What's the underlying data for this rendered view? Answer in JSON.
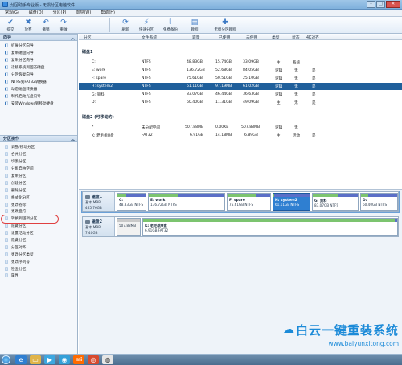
{
  "window": {
    "title": "分区助手专业版 - 无损分区电脑软件",
    "minimize": "–",
    "maximize": "□",
    "close": "✕"
  },
  "menu": [
    "常规(G)",
    "磁盘(D)",
    "分区(P)",
    "向导(W)",
    "帮助(H)"
  ],
  "toolbar": {
    "left": [
      {
        "label": "提交",
        "icon": "✔"
      },
      {
        "label": "放弃",
        "icon": "✖"
      },
      {
        "label": "撤销",
        "icon": "↶"
      },
      {
        "label": "重做",
        "icon": "↷"
      }
    ],
    "right": [
      {
        "label": "刷新",
        "icon": "⟳"
      },
      {
        "label": "快速分区",
        "icon": "⚡"
      },
      {
        "label": "免费备份",
        "icon": "⇩"
      },
      {
        "label": "教程",
        "icon": "▤"
      },
      {
        "label": "无损分区教程",
        "icon": "✚"
      }
    ]
  },
  "sidebar": {
    "wizard": {
      "header": "向导",
      "collapse": "︽",
      "items": [
        {
          "label": "扩展分区向导",
          "icon": "◧"
        },
        {
          "label": "复制磁盘向导",
          "icon": "◧"
        },
        {
          "label": "复制分区向导",
          "icon": "◧"
        },
        {
          "label": "迁移系统到固态硬盘",
          "icon": "◧"
        },
        {
          "label": "分区恢复向导",
          "icon": "◧"
        },
        {
          "label": "NTFS到FAT32转换器",
          "icon": "◧"
        },
        {
          "label": "动态磁盘转换器",
          "icon": "◧"
        },
        {
          "label": "制作启动光盘向导",
          "icon": "◧"
        },
        {
          "label": "安装Windows到移动硬盘",
          "icon": "◧"
        }
      ]
    },
    "ops": {
      "header": "分区操作",
      "collapse": "︽",
      "items": [
        {
          "label": "调整/移动分区",
          "icon": "◫"
        },
        {
          "label": "合并分区",
          "icon": "◫"
        },
        {
          "label": "切割分区",
          "icon": "◫"
        },
        {
          "label": "分配自由空间",
          "icon": "◫"
        },
        {
          "label": "复制分区",
          "icon": "◫"
        },
        {
          "label": "创建分区",
          "icon": "◫"
        },
        {
          "label": "删除分区",
          "icon": "◫"
        },
        {
          "label": "格式化分区",
          "icon": "◫"
        },
        {
          "label": "更改卷标",
          "icon": "◫"
        },
        {
          "label": "更改盘符",
          "icon": "◫"
        },
        {
          "label": "转换到逻辑分区",
          "icon": "◫"
        },
        {
          "label": "隐藏分区",
          "icon": "◫"
        },
        {
          "label": "设置活动分区",
          "icon": "◫"
        },
        {
          "label": "隐藏分区",
          "icon": "◫"
        },
        {
          "label": "分区对齐",
          "icon": "◫"
        },
        {
          "label": "更改分区类型",
          "icon": "◫"
        },
        {
          "label": "更改序列号",
          "icon": "◫"
        },
        {
          "label": "检查分区",
          "icon": "◫"
        },
        {
          "label": "属性",
          "icon": "◫"
        }
      ]
    }
  },
  "table": {
    "columns": [
      "分区",
      "文件系统",
      "容量",
      "已使用",
      "未使用",
      "类型",
      "状态",
      "4K对齐"
    ],
    "disks": [
      {
        "name": "磁盘1",
        "rows": [
          {
            "partition": "C:",
            "fs": "NTFS",
            "capacity": "48.83GB",
            "used": "15.74GB",
            "free": "33.09GB",
            "type": "主",
            "status": "系统",
            "align": ""
          },
          {
            "partition": "E: work",
            "fs": "NTFS",
            "capacity": "136.72GB",
            "used": "52.68GB",
            "free": "84.05GB",
            "type": "逻辑",
            "status": "无",
            "align": "是"
          },
          {
            "partition": "F: spare",
            "fs": "NTFS",
            "capacity": "75.61GB",
            "used": "50.51GB",
            "free": "25.10GB",
            "type": "逻辑",
            "status": "无",
            "align": "是"
          },
          {
            "partition": "H: system2",
            "fs": "NTFS",
            "capacity": "61.11GB",
            "used": "97.19MB",
            "free": "61.02GB",
            "type": "逻辑",
            "status": "无",
            "align": "是"
          },
          {
            "partition": "G: 资料",
            "fs": "NTFS",
            "capacity": "83.07GB",
            "used": "46.44GB",
            "free": "36.63GB",
            "type": "逻辑",
            "status": "无",
            "align": "是"
          },
          {
            "partition": "D:",
            "fs": "NTFS",
            "capacity": "60.40GB",
            "used": "11.31GB",
            "free": "49.09GB",
            "type": "主",
            "status": "无",
            "align": "是"
          }
        ]
      },
      {
        "name": "磁盘2 (可移动的)",
        "rows": [
          {
            "partition": "*",
            "fs": "未分配空间",
            "capacity": "507.88MB",
            "used": "0.00KB",
            "free": "507.88MB",
            "type": "逻辑",
            "status": "无",
            "align": ""
          },
          {
            "partition": "K: 老毛桃U盘",
            "fs": "FAT32",
            "capacity": "6.91GB",
            "used": "14.18MB",
            "free": "6.89GB",
            "type": "主",
            "status": "活动",
            "align": "是"
          }
        ]
      }
    ]
  },
  "diskmap": {
    "disk1": {
      "name": "磁盘1",
      "sub1": "基本 MBR",
      "sub2": "465.76GB",
      "parts": [
        {
          "label": "C:",
          "size": "48.83GB NTFS",
          "used": 0.32
        },
        {
          "label": "E: work",
          "size": "136.72GB NTFS",
          "used": 0.39
        },
        {
          "label": "F: spare",
          "size": "75.61GB NTFS",
          "used": 0.67
        },
        {
          "label": "H: system2",
          "size": "61.11GB NTFS",
          "used": 0.02
        },
        {
          "label": "G: 资料",
          "size": "83.07GB NTFS",
          "used": 0.56
        },
        {
          "label": "D:",
          "size": "60.40GB NTFS",
          "used": 0.19
        }
      ]
    },
    "disk2": {
      "name": "磁盘2",
      "sub1": "基本 MBR",
      "sub2": "7.40GB",
      "parts": [
        {
          "label": "",
          "size": "507.88MB",
          "used": 0
        },
        {
          "label": "K: 老毛桃U盘",
          "size": "6.91GB FAT32",
          "used": 0.99
        }
      ]
    }
  },
  "taskbar": {
    "icons": [
      "start-orb",
      "ie",
      "folder",
      "media",
      "qq",
      "mi",
      "browser",
      "chrome"
    ],
    "mi_label": "mi"
  },
  "watermark": {
    "title": "白云一键重装系统",
    "url": "www.baiyunxitong.com"
  }
}
